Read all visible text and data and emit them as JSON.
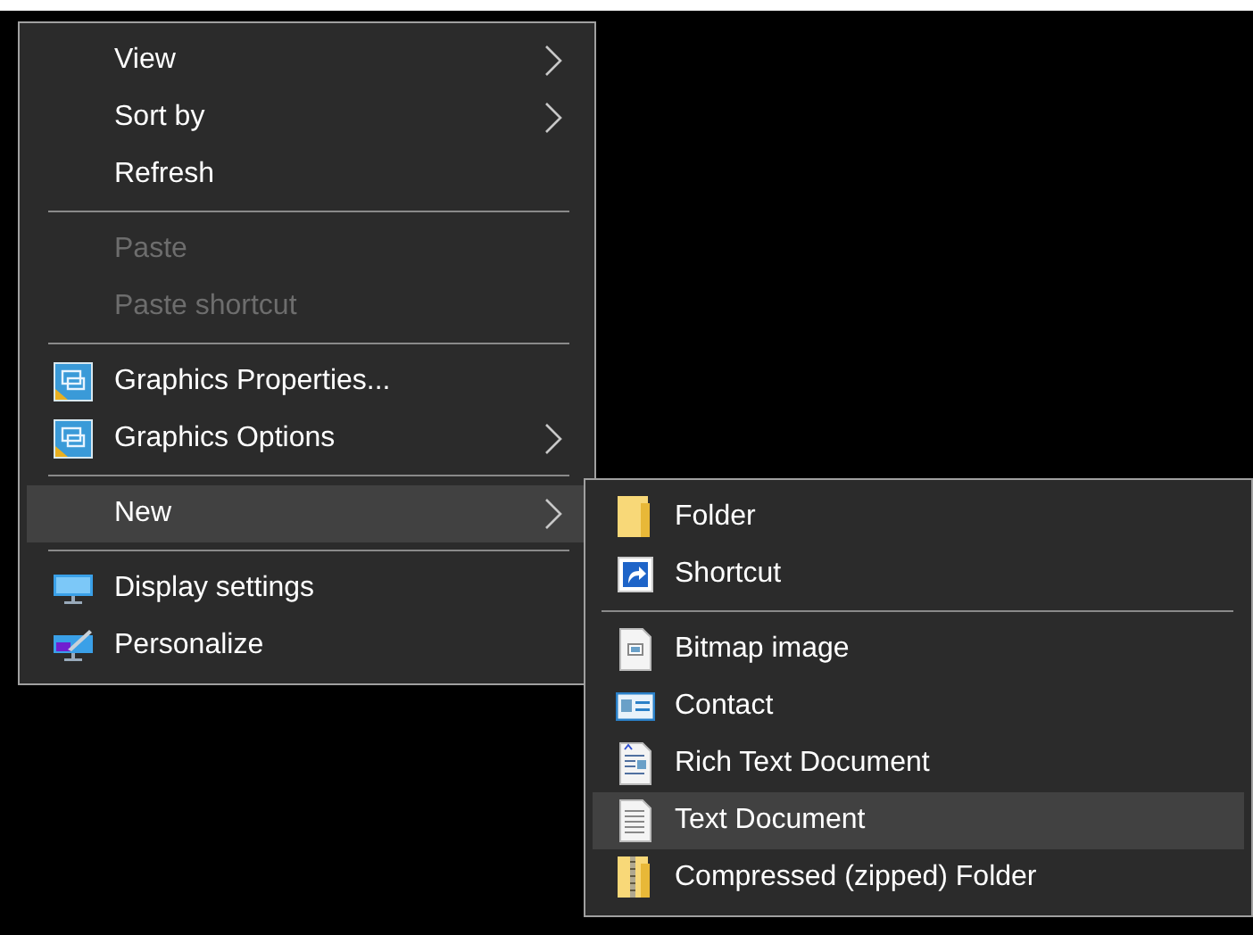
{
  "context_menu": {
    "items": [
      {
        "kind": "item",
        "label": "View",
        "submenu": true,
        "disabled": false,
        "selected": false
      },
      {
        "kind": "item",
        "label": "Sort by",
        "submenu": true,
        "disabled": false,
        "selected": false
      },
      {
        "kind": "item",
        "label": "Refresh",
        "submenu": false,
        "disabled": false,
        "selected": false
      },
      {
        "kind": "separator"
      },
      {
        "kind": "item",
        "label": "Paste",
        "submenu": false,
        "disabled": true,
        "selected": false
      },
      {
        "kind": "item",
        "label": "Paste shortcut",
        "submenu": false,
        "disabled": true,
        "selected": false
      },
      {
        "kind": "separator"
      },
      {
        "kind": "item",
        "label": "Graphics Properties...",
        "submenu": false,
        "disabled": false,
        "selected": false
      },
      {
        "kind": "item",
        "label": "Graphics Options",
        "submenu": true,
        "disabled": false,
        "selected": false
      },
      {
        "kind": "separator"
      },
      {
        "kind": "item",
        "label": "New",
        "submenu": true,
        "disabled": false,
        "selected": true
      },
      {
        "kind": "separator"
      },
      {
        "kind": "item",
        "label": "Display settings",
        "submenu": false,
        "disabled": false,
        "selected": false
      },
      {
        "kind": "item",
        "label": "Personalize",
        "submenu": false,
        "disabled": false,
        "selected": false
      }
    ]
  },
  "new_submenu": {
    "items": [
      {
        "kind": "item",
        "label": "Folder",
        "selected": false
      },
      {
        "kind": "item",
        "label": "Shortcut",
        "selected": false
      },
      {
        "kind": "separator"
      },
      {
        "kind": "item",
        "label": "Bitmap image",
        "selected": false
      },
      {
        "kind": "item",
        "label": "Contact",
        "selected": false
      },
      {
        "kind": "item",
        "label": "Rich Text Document",
        "selected": false
      },
      {
        "kind": "item",
        "label": "Text Document",
        "selected": true
      },
      {
        "kind": "item",
        "label": "Compressed (zipped) Folder",
        "selected": false
      }
    ]
  }
}
